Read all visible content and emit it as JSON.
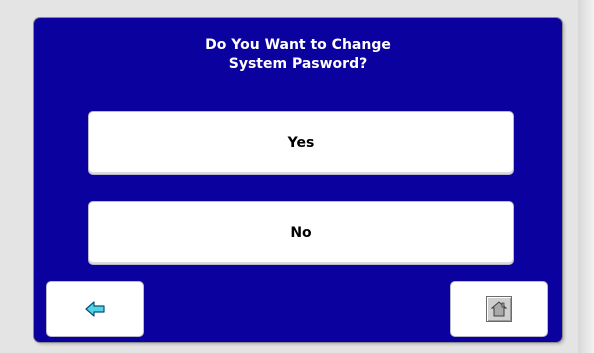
{
  "dialog": {
    "title_line1": "Do You Want to Change",
    "title_line2": "System Pasword?"
  },
  "options": {
    "yes_label": "Yes",
    "no_label": "No"
  },
  "nav": {
    "back_icon": "arrow-left-icon",
    "home_icon": "home-icon"
  },
  "colors": {
    "panel_background": "#0a019e",
    "button_background": "#ffffff",
    "back_arrow_fill": "#4fd6e6"
  }
}
